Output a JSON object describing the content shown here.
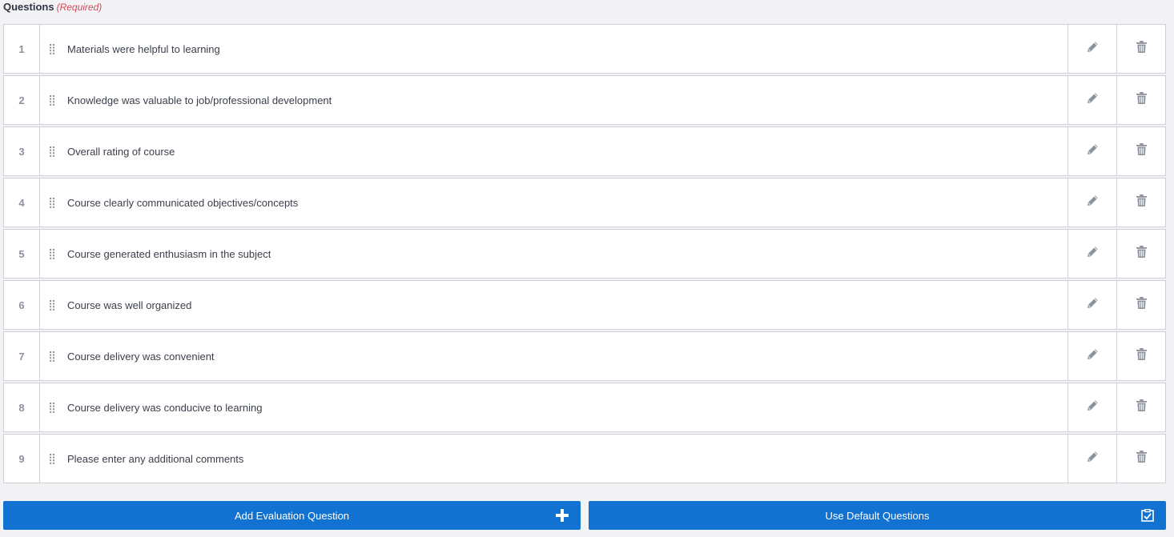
{
  "header": {
    "title": "Questions",
    "required_note": "(Required)"
  },
  "questions": [
    {
      "number": "1",
      "text": "Materials were helpful to learning"
    },
    {
      "number": "2",
      "text": "Knowledge was valuable to job/professional development"
    },
    {
      "number": "3",
      "text": "Overall rating of course"
    },
    {
      "number": "4",
      "text": "Course clearly communicated objectives/concepts"
    },
    {
      "number": "5",
      "text": "Course generated enthusiasm in the subject"
    },
    {
      "number": "6",
      "text": "Course was well organized"
    },
    {
      "number": "7",
      "text": "Course delivery was convenient"
    },
    {
      "number": "8",
      "text": "Course delivery was conducive to learning"
    },
    {
      "number": "9",
      "text": "Please enter any additional comments"
    }
  ],
  "row_icons": {
    "drag": "drag-handle-icon",
    "edit": "pencil-icon",
    "delete": "trash-icon"
  },
  "buttons": {
    "add_question": {
      "label": "Add Evaluation Question",
      "icon": "plus-icon"
    },
    "use_defaults": {
      "label": "Use Default Questions",
      "icon": "checklist-icon"
    }
  },
  "colors": {
    "accent": "#1272d1",
    "required": "#d24b5a",
    "icon": "#8d92a0",
    "border": "#cfd1d6",
    "background": "#f3f3f5"
  }
}
